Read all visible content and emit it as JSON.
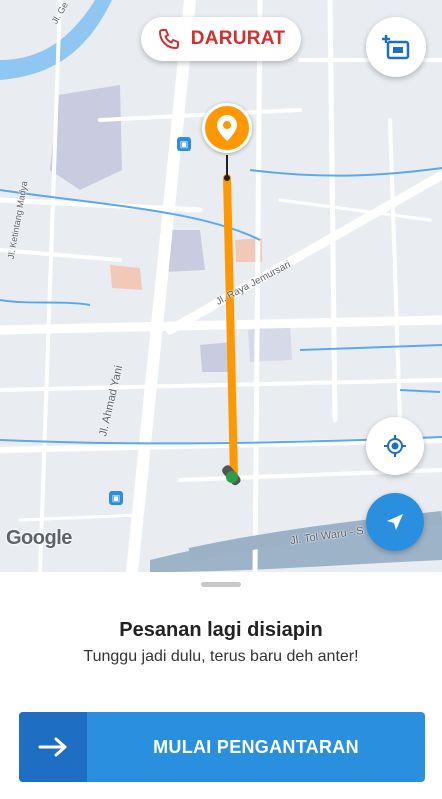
{
  "map": {
    "roads": [
      "Jl. Ahmad Yani",
      "Jl. Raya Jemursari",
      "Jl. Ketintang Madya",
      "Jl. Tol Waru - S",
      "Jl. Ge"
    ],
    "route_color": "#ff9800",
    "provider": "Google"
  },
  "emergency": {
    "label": "DARURAT",
    "icon": "phone-icon",
    "color": "#d32f2f"
  },
  "buttons": {
    "add_stop_icon": "add-destination-icon",
    "recenter_icon": "my-location-icon",
    "navigate_icon": "navigation-arrow-icon"
  },
  "sheet": {
    "title": "Pesanan lagi disiapin",
    "subtitle": "Tunggu jadi dulu, terus baru deh anter!",
    "action_label": "MULAI PENGANTARAN",
    "action_color": "#2b8fe0"
  }
}
